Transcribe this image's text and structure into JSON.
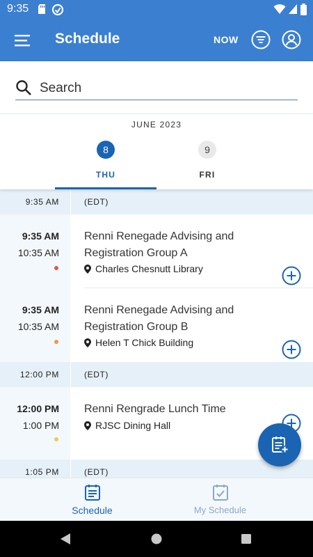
{
  "status_bar": {
    "time": "9:35"
  },
  "app_bar": {
    "title": "Schedule",
    "now_label": "NOW"
  },
  "search": {
    "placeholder": "Search"
  },
  "date_bar": {
    "month": "JUNE 2023",
    "days": [
      {
        "num": "8",
        "dow": "THU",
        "selected": true
      },
      {
        "num": "9",
        "dow": "FRI",
        "selected": false
      }
    ]
  },
  "schedule": {
    "bands": [
      {
        "time": "9:35 AM",
        "zone": "(EDT)"
      },
      {
        "time": "12:00 PM",
        "zone": "(EDT)"
      },
      {
        "time": "1:05 PM",
        "zone": "(EDT)"
      }
    ],
    "events": [
      {
        "start": "9:35 AM",
        "end": "10:35 AM",
        "title": "Renni Renegade Advising and Registration Group A",
        "location": "Charles Chesnutt Library",
        "dot_color": "#e5534b"
      },
      {
        "start": "9:35 AM",
        "end": "10:35 AM",
        "title": "Renni Renegade Advising and Registration Group B",
        "location": "Helen T Chick Building",
        "dot_color": "#f0954a"
      },
      {
        "start": "12:00 PM",
        "end": "1:00 PM",
        "title": "Renni Rengrade Lunch Time",
        "location": "RJSC Dining Hall",
        "dot_color": "#f2c94c"
      }
    ]
  },
  "bottom_nav": {
    "items": [
      {
        "label": "Schedule",
        "active": true
      },
      {
        "label": "My Schedule",
        "active": false
      }
    ]
  },
  "colors": {
    "primary": "#1a64b3",
    "app_bar": "#3b7fd0",
    "band": "#e6f0f8"
  }
}
